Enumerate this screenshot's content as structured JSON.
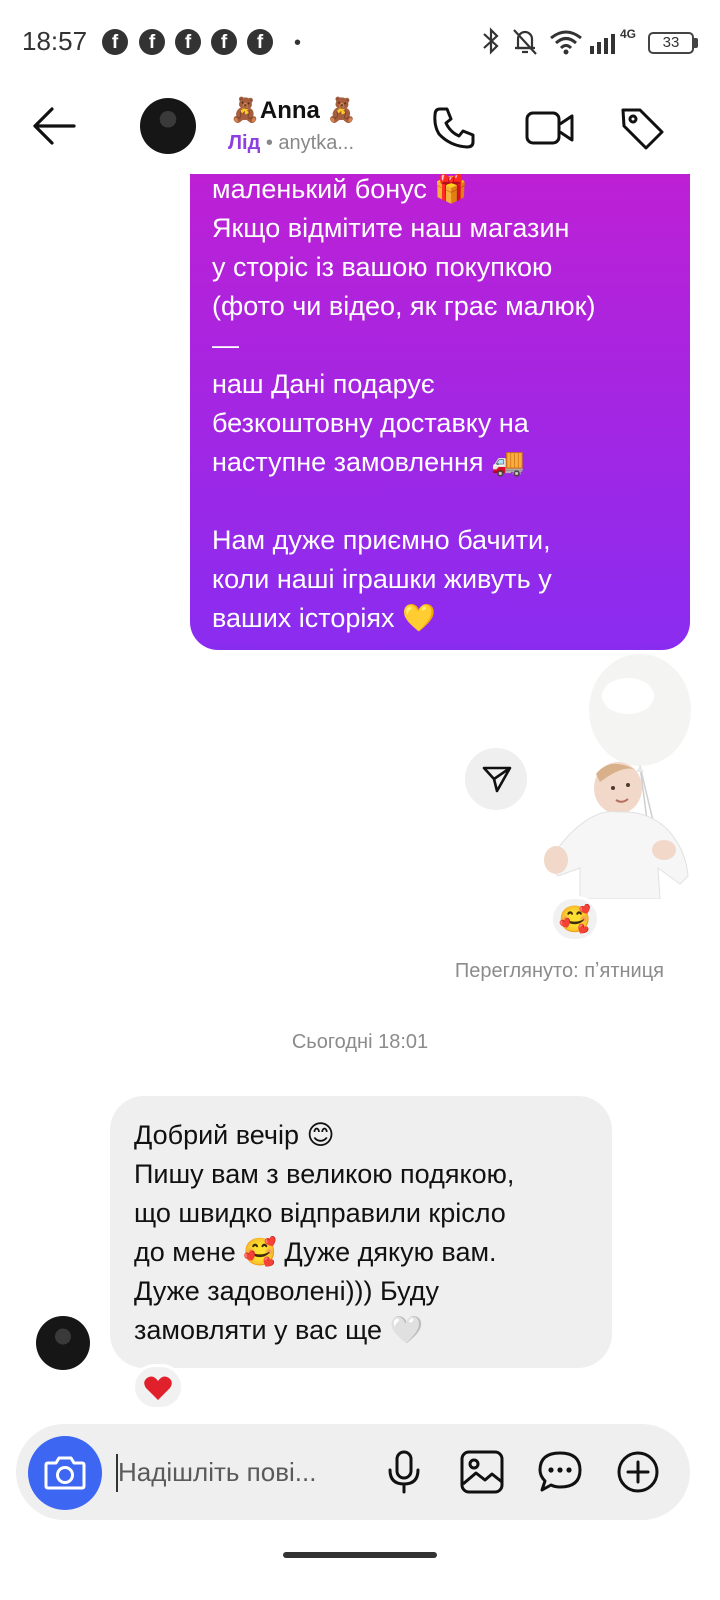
{
  "status_bar": {
    "time": "18:57",
    "notification_icon_names": [
      "facebook-icon",
      "facebook-icon",
      "facebook-icon",
      "facebook-icon",
      "facebook-icon"
    ],
    "network_label": "4G",
    "battery": "33"
  },
  "header": {
    "name": "🧸Anna 🧸",
    "lead_label": "Лід",
    "separator": " • ",
    "username": "anytka..."
  },
  "messages": {
    "outgoing_lines": [
      "маленький бонус 🎁",
      "Якщо відмітите наш магазин",
      "у сторіс із вашою покупкою",
      "(фото чи відео, як грає малюк)",
      "—",
      "наш Дані подарує",
      "безкоштовну доставку на",
      "наступне замовлення 🚚",
      "",
      "Нам дуже приємно бачити,",
      "коли наші іграшки живуть у",
      "ваших історіях 💛"
    ],
    "sticker_reaction": "🥰",
    "seen_label": "Переглянуто: пʼятниця",
    "date_separator": "Сьогодні 18:01",
    "incoming_lines": [
      "Добрий вечір 😊",
      "Пишу вам з великою подякою,",
      "що швидко відправили крісло",
      "до мене 🥰 Дуже дякую вам.",
      "Дуже задоволені)))   Буду",
      "замовляти у вас ще 🤍"
    ],
    "incoming_reaction": "heart"
  },
  "composer": {
    "placeholder": "Надішліть пові..."
  },
  "colors": {
    "bubble_gradient_top": "#c21fd2",
    "bubble_gradient_bottom": "#8a2cf0",
    "lead_label": "#8e3fe0",
    "camera_button": "#3d67f2",
    "reaction_heart": "#e0202a"
  }
}
